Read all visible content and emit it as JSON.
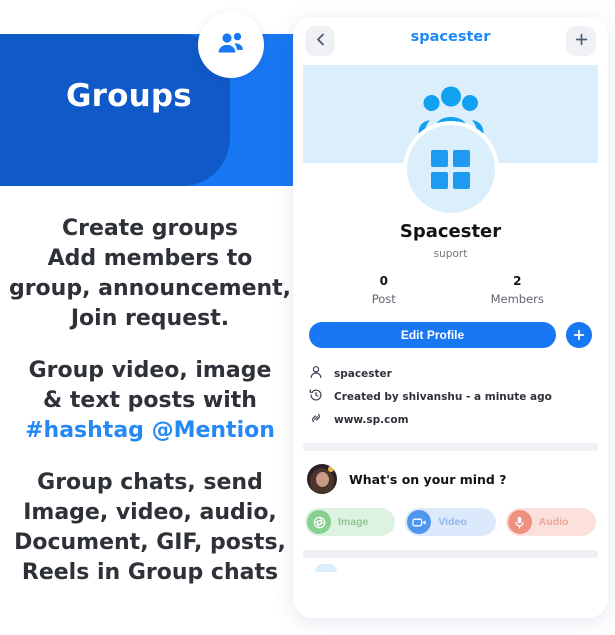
{
  "promo": {
    "banner_title": "Groups",
    "badge_icon": "group-people-icon",
    "paragraphs": [
      "Create groups\nAdd members to\ngroup, announcement,\nJoin request.",
      "Group video, image\n& text posts with",
      "Group chats, send\nImage, video, audio,\nDocument, GIF, posts,\nReels in Group chats"
    ],
    "highlight_line": "#hashtag @Mention",
    "colors": {
      "banner_bright": "#1877F2",
      "banner_dark": "#1059C8",
      "highlight": "#2489F4",
      "copy": "#2e3238"
    }
  },
  "phone": {
    "nav": {
      "back_icon": "chevron-left-icon",
      "title": "spacester",
      "add_icon": "plus-icon",
      "title_color": "#1E88F5"
    },
    "cover": {
      "icon": "group-people-icon",
      "background": "#DAEEFB"
    },
    "avatar": {
      "icon": "grid-squares-icon",
      "icon_color": "#1E9BF0"
    },
    "profile": {
      "name": "Spacester",
      "subtitle": "suport"
    },
    "stats": [
      {
        "value": "0",
        "label": "Post"
      },
      {
        "value": "2",
        "label": "Members"
      }
    ],
    "actions": {
      "edit_profile_label": "Edit Profile",
      "add_icon": "plus-icon",
      "accent": "#1877F2"
    },
    "info": [
      {
        "icon": "person-icon",
        "text": "spacester"
      },
      {
        "icon": "history-clock-icon",
        "text": "Created by shivanshu - a minute ago"
      },
      {
        "icon": "link-icon",
        "text": "www.sp.com"
      }
    ],
    "composer": {
      "avatar_icon": "user-photo-avatar",
      "placeholder": "What's on your mind ?"
    },
    "attachments": [
      {
        "label": "Image",
        "icon": "image-aperture-icon",
        "pill_bg": "#DDF2E0",
        "icon_bg": "#86D18F",
        "text_color": "#8CCB95"
      },
      {
        "label": "Video",
        "icon": "video-camera-icon",
        "pill_bg": "#DCE8FB",
        "icon_bg": "#4E97F0",
        "text_color": "#8FB8EC"
      },
      {
        "label": "Audio",
        "icon": "microphone-icon",
        "pill_bg": "#FBE0DC",
        "icon_bg": "#EE9181",
        "text_color": "#EFA496"
      }
    ]
  }
}
